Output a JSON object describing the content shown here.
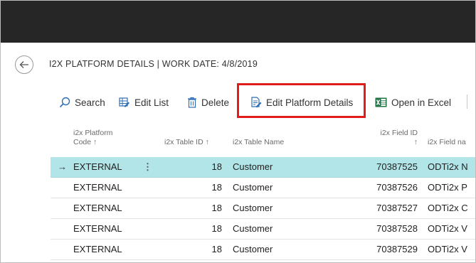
{
  "page": {
    "title": "I2X PLATFORM DETAILS | WORK DATE: 4/8/2019"
  },
  "actions": {
    "search": "Search",
    "edit_list": "Edit List",
    "delete": "Delete",
    "edit_platform_details": "Edit Platform Details",
    "open_in_excel": "Open in Excel"
  },
  "columns": {
    "code_line1": "i2x Platform",
    "code_line2": "Code ↑",
    "table_id": "i2x Table ID ↑",
    "table_name": "i2x Table Name",
    "field_id_line1": "i2x Field ID",
    "field_id_line2": "↑",
    "field_name": "i2x Field na"
  },
  "rows": [
    {
      "arrow": "→",
      "code": "EXTERNAL",
      "menu": "⋮",
      "table_id": "18",
      "table_name": "Customer",
      "field_id": "70387525",
      "field_name": "ODTi2x N"
    },
    {
      "arrow": "",
      "code": "EXTERNAL",
      "menu": "",
      "table_id": "18",
      "table_name": "Customer",
      "field_id": "70387526",
      "field_name": "ODTi2x P"
    },
    {
      "arrow": "",
      "code": "EXTERNAL",
      "menu": "",
      "table_id": "18",
      "table_name": "Customer",
      "field_id": "70387527",
      "field_name": "ODTi2x C"
    },
    {
      "arrow": "",
      "code": "EXTERNAL",
      "menu": "",
      "table_id": "18",
      "table_name": "Customer",
      "field_id": "70387528",
      "field_name": "ODTi2x V"
    },
    {
      "arrow": "",
      "code": "EXTERNAL",
      "menu": "",
      "table_id": "18",
      "table_name": "Customer",
      "field_id": "70387529",
      "field_name": "ODTi2x V"
    }
  ],
  "icons": {
    "back": "back-arrow-icon",
    "search": "search-icon",
    "edit_list": "edit-list-icon",
    "delete": "trash-icon",
    "edit_platform_details": "edit-document-icon",
    "open_in_excel": "excel-icon"
  },
  "colors": {
    "topbar": "#262626",
    "selected_row": "#b2e5e7",
    "accent_blue": "#2f6eb5",
    "excel_green": "#217346",
    "highlight_red": "#e21b1b"
  }
}
